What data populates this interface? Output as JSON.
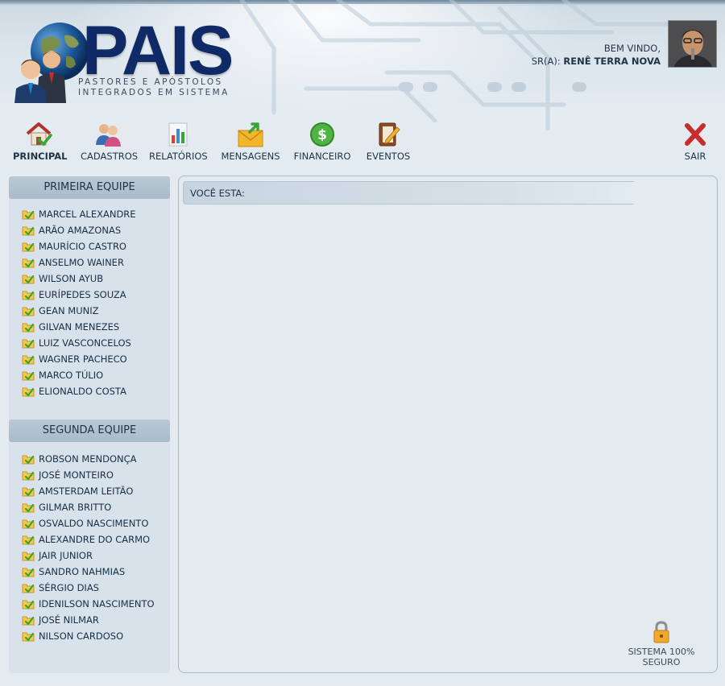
{
  "logo": {
    "word": "PAIS",
    "sub_line1": "PASTORES E APÓSTOLOS",
    "sub_line2": "INTEGRADOS EM SISTEMA"
  },
  "user": {
    "welcome": "BEM VINDO,",
    "prefix": "SR(A):",
    "name": "RENÊ TERRA NOVA"
  },
  "nav": {
    "principal": "PRINCIPAL",
    "cadastros": "CADASTROS",
    "relatorios": "RELATÓRIOS",
    "mensagens": "MENSAGENS",
    "financeiro": "FINANCEIRO",
    "eventos": "EVENTOS",
    "sair": "SAIR"
  },
  "sidebar": {
    "group1": {
      "title": "PRIMEIRA EQUIPE",
      "items": [
        "MARCEL ALEXANDRE",
        "ARÃO AMAZONAS",
        "MAURÍCIO CASTRO",
        "ANSELMO WAINER",
        "WILSON AYUB",
        "EURÍPEDES SOUZA",
        "GEAN MUNIZ",
        "GILVAN MENEZES",
        "LUIZ VASCONCELOS",
        "WAGNER PACHECO",
        "MARCO TÚLIO",
        "ELIONALDO COSTA"
      ]
    },
    "group2": {
      "title": "SEGUNDA EQUIPE",
      "items": [
        "ROBSON MENDONÇA",
        "JOSÉ MONTEIRO",
        "AMSTERDAM LEITÃO",
        "GILMAR BRITTO",
        "OSVALDO NASCIMENTO",
        "ALEXANDRE DO CARMO",
        "JAIR JUNIOR",
        "SANDRO NAHMIAS",
        "SÉRGIO DIAS",
        "IDENILSON NASCIMENTO",
        "JOSÉ NILMAR",
        "NILSON CARDOSO"
      ]
    }
  },
  "main": {
    "breadcrumb": "VOCÊ ESTA:",
    "secure": "SISTEMA 100% SEGURO"
  },
  "icons": {
    "home": "house-check-icon",
    "cadastros": "users-icon",
    "relatorios": "bar-chart-icon",
    "mensagens": "envelope-icon",
    "financeiro": "dollar-coin-icon",
    "eventos": "notebook-pencil-icon",
    "sair": "close-x-icon",
    "folder": "folder-check-icon",
    "lock": "lock-icon"
  },
  "colors": {
    "brand": "#0f2a66",
    "accent": "#a9bccb",
    "background": "#e3eaf0",
    "exit": "#d42d2d"
  }
}
